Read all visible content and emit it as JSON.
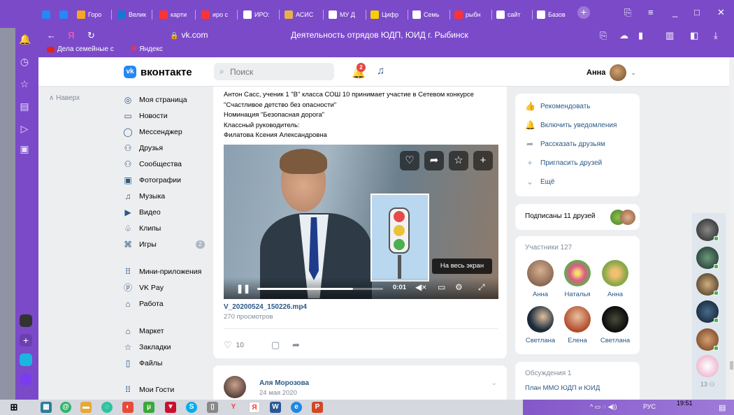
{
  "browser": {
    "tabs": [
      {
        "label": "Горо",
        "color": "#f5a623"
      },
      {
        "label": "Велик",
        "color": "#1976d2"
      },
      {
        "label": "карти",
        "color": "#f33"
      },
      {
        "label": "иро с",
        "color": "#f33"
      },
      {
        "label": "ИРО:",
        "color": "#ffffff"
      },
      {
        "label": "АСИС",
        "color": "#e8b04a"
      },
      {
        "label": "МУ Д",
        "color": "#ffffff"
      },
      {
        "label": "Цифр",
        "color": "#f5d000"
      },
      {
        "label": "Семь",
        "color": "#ffffff"
      },
      {
        "label": "рыбн",
        "color": "#f33"
      },
      {
        "label": "сайт",
        "color": "#ffffff"
      },
      {
        "label": "Базов",
        "color": "#ffffff"
      }
    ],
    "url": "vk.com",
    "page_title": "Деятельность отрядов ЮДП, ЮИД г. Рыбинск",
    "bookmarks": [
      "Дела семейные с",
      "Яндекс"
    ]
  },
  "vk": {
    "logo": "вконтакте",
    "search_placeholder": "Поиск",
    "notif_count": "2",
    "user_name": "Анна",
    "up_label": "Наверх",
    "menu": [
      {
        "label": "Моя страница",
        "icon": "user-circle-icon",
        "glyph": "◎"
      },
      {
        "label": "Новости",
        "icon": "news-icon",
        "glyph": "▭"
      },
      {
        "label": "Мессенджер",
        "icon": "chat-icon",
        "glyph": "◯"
      },
      {
        "label": "Друзья",
        "icon": "friends-icon",
        "glyph": "⚇"
      },
      {
        "label": "Сообщества",
        "icon": "groups-icon",
        "glyph": "⚇"
      },
      {
        "label": "Фотографии",
        "icon": "photo-icon",
        "glyph": "▣"
      },
      {
        "label": "Музыка",
        "icon": "music-icon",
        "glyph": "♫"
      },
      {
        "label": "Видео",
        "icon": "video-icon",
        "glyph": "▶"
      },
      {
        "label": "Клипы",
        "icon": "clips-icon",
        "glyph": "♧"
      },
      {
        "label": "Игры",
        "icon": "games-icon",
        "glyph": "⌘",
        "count": "2"
      },
      {
        "label": "Мини-приложения",
        "icon": "apps-icon",
        "glyph": "⠿"
      },
      {
        "label": "VK Pay",
        "icon": "pay-icon",
        "glyph": "ⓟ"
      },
      {
        "label": "Работа",
        "icon": "work-icon",
        "glyph": "⌂"
      },
      {
        "label": "Маркет",
        "icon": "market-icon",
        "glyph": "⌂"
      },
      {
        "label": "Закладки",
        "icon": "bookmark-icon",
        "glyph": "☆"
      },
      {
        "label": "Файлы",
        "icon": "file-icon",
        "glyph": "▯"
      },
      {
        "label": "Мои Гости",
        "icon": "guests-icon",
        "glyph": "⠿"
      }
    ]
  },
  "post": {
    "lines": [
      "Антон Сасс, ученик 1 \"В\" класса СОШ 10 принимает участие в Сетевом конкурсе",
      "\"Счастливое детство без опасности\"",
      "Номинация \"Безопасная дорога\"",
      "Классный руководитель:",
      "Филатова Ксения Александровна"
    ],
    "video_time": "0:01",
    "video_progress": 0.76,
    "fullscreen_tip": "На весь экран",
    "file_name": "V_20200524_150226.mp4",
    "views": "270 просмотров",
    "likes": "10"
  },
  "post2": {
    "author": "Аля Морозова",
    "date": "24 мая 2020"
  },
  "right": {
    "actions": [
      {
        "label": "Рекомендовать",
        "icon": "thumbs-up-icon",
        "glyph": "👍"
      },
      {
        "label": "Включить уведомления",
        "icon": "bell-icon",
        "glyph": "🔔"
      },
      {
        "label": "Рассказать друзьям",
        "icon": "share-icon",
        "glyph": "➦"
      },
      {
        "label": "Пригласить друзей",
        "icon": "invite-icon",
        "glyph": "+"
      },
      {
        "label": "Ещё",
        "icon": "chevron-down-icon",
        "glyph": "⌄"
      }
    ],
    "friends_subscribed": "Подписаны 11 друзей",
    "members_title": "Участники",
    "members_count": "127",
    "members": [
      "Анна",
      "Наталья",
      "Анна",
      "Светлана",
      "Елена",
      "Светлана"
    ],
    "discussions_title": "Обсуждения",
    "discussions_count": "1",
    "discussion_item": "План ММО ЮДП и ЮИД"
  },
  "online_count": "13",
  "taskbar": {
    "lang": "РУС",
    "time": "19:51"
  }
}
